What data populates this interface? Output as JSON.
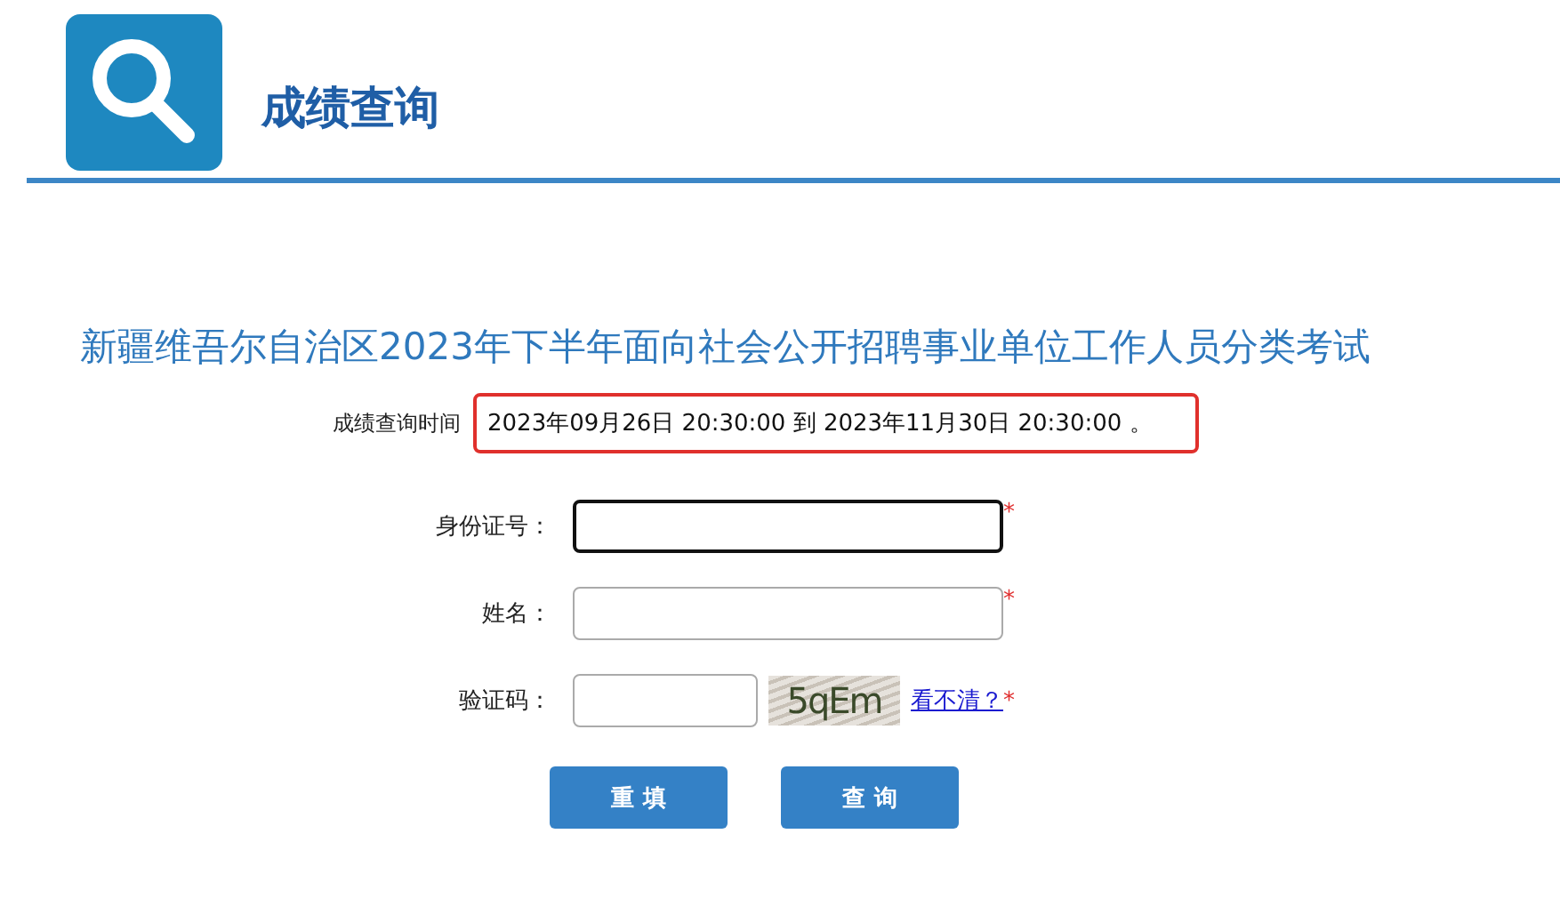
{
  "header": {
    "title": "成绩查询"
  },
  "exam_title": "新疆维吾尔自治区2023年下半年面向社会公开招聘事业单位工作人员分类考试",
  "query_time": {
    "label": "成绩查询时间",
    "value": "2023年09月26日 20:30:00 到 2023年11月30日 20:30:00 。"
  },
  "form": {
    "fields": [
      {
        "kind": "text",
        "label": "身份证号：",
        "required_mark": "*",
        "focused": true
      },
      {
        "kind": "text",
        "label": "姓名：",
        "required_mark": "*",
        "focused": false
      },
      {
        "kind": "captcha",
        "label": "验证码：",
        "required_mark": "*",
        "focused": false,
        "captcha": "5qEm",
        "refresh_link": "看不清？"
      }
    ]
  },
  "buttons": [
    {
      "label": "重 填"
    },
    {
      "label": "查 询"
    }
  ]
}
